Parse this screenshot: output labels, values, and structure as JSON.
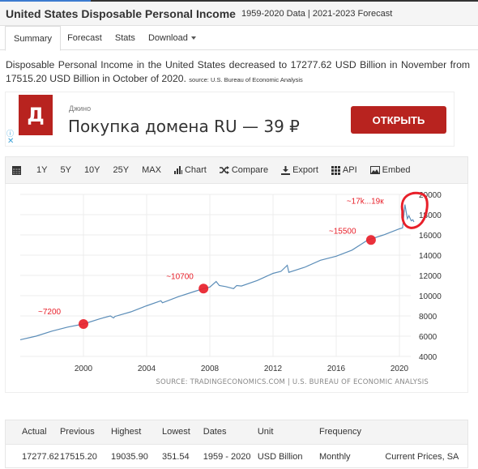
{
  "header": {
    "title": "United States Disposable Personal Income",
    "subtitle": "1959-2020 Data | 2021-2023 Forecast"
  },
  "tabs": [
    {
      "label": "Summary",
      "active": true
    },
    {
      "label": "Forecast"
    },
    {
      "label": "Stats"
    },
    {
      "label": "Download"
    }
  ],
  "description": {
    "text": "Disposable Personal Income in the United States decreased to 17277.62 USD Billion in November from 17515.20 USD Billion in October of 2020.",
    "source": "source: U.S. Bureau of Economic Analysis"
  },
  "ad": {
    "logo_letter": "Д",
    "brand": "Джино",
    "title": "Покупка домена RU — 39 ₽",
    "button": "ОТКРЫТЬ",
    "info_icon": "ⓘ",
    "close_icon": "✕",
    "accent": "#b8231f"
  },
  "toolbar": {
    "ranges": [
      "1Y",
      "5Y",
      "10Y",
      "25Y",
      "MAX"
    ],
    "chart": "Chart",
    "compare": "Compare",
    "export": "Export",
    "api": "API",
    "embed": "Embed"
  },
  "chart_data": {
    "type": "line",
    "title": "United States Disposable Personal Income",
    "xlabel": "",
    "ylabel": "USD Billion",
    "x_ticks": [
      2000,
      2004,
      2008,
      2012,
      2016,
      2020
    ],
    "y_ticks": [
      4000,
      6000,
      8000,
      10000,
      12000,
      14000,
      16000,
      18000,
      20000
    ],
    "xlim": [
      1996,
      2021.5
    ],
    "ylim": [
      4000,
      20000
    ],
    "grid": true,
    "line_color": "#5b8db8",
    "series": [
      {
        "name": "Disposable Personal Income",
        "x": [
          1996.0,
          1997.0,
          1998.0,
          1999.0,
          2000.0,
          2001.0,
          2001.7,
          2001.9,
          2002.0,
          2003.0,
          2004.0,
          2004.9,
          2005.0,
          2006.0,
          2007.0,
          2007.6,
          2008.0,
          2008.4,
          2008.6,
          2009.0,
          2009.5,
          2009.7,
          2010.0,
          2011.0,
          2012.0,
          2012.5,
          2012.9,
          2013.0,
          2014.0,
          2015.0,
          2016.0,
          2017.0,
          2018.0,
          2019.0,
          2020.0,
          2020.2,
          2020.35,
          2020.5,
          2020.6,
          2020.75,
          2020.85,
          2020.92
        ],
        "y": [
          5650,
          6000,
          6500,
          6900,
          7200,
          7700,
          8000,
          7800,
          7950,
          8400,
          9000,
          9500,
          9300,
          9900,
          10400,
          10700,
          10850,
          11400,
          11000,
          10900,
          10700,
          11000,
          10950,
          11500,
          12200,
          12400,
          13000,
          12300,
          12800,
          13500,
          13900,
          14500,
          15500,
          16000,
          16600,
          16700,
          19000,
          17600,
          17900,
          17400,
          17500,
          17277.62
        ]
      }
    ],
    "annotations": [
      {
        "label": "~7200",
        "x": 2000.0,
        "y": 7200
      },
      {
        "label": "~10700",
        "x": 2007.6,
        "y": 10700
      },
      {
        "label": "~15500",
        "x": 2018.2,
        "y": 15500
      },
      {
        "label": "~17k...19к",
        "x": 2020.4,
        "y": 18200
      }
    ],
    "annotation_color": "#e8202a",
    "source": "SOURCE: TRADINGECONOMICS.COM | U.S. BUREAU OF ECONOMIC ANALYSIS"
  },
  "stats": {
    "headers": [
      "Actual",
      "Previous",
      "Highest",
      "Lowest",
      "Dates",
      "Unit",
      "Frequency",
      ""
    ],
    "values": [
      "17277.62",
      "17515.20",
      "19035.90",
      "351.54",
      "1959 - 2020",
      "USD Billion",
      "Monthly",
      "Current Prices, SA"
    ]
  }
}
